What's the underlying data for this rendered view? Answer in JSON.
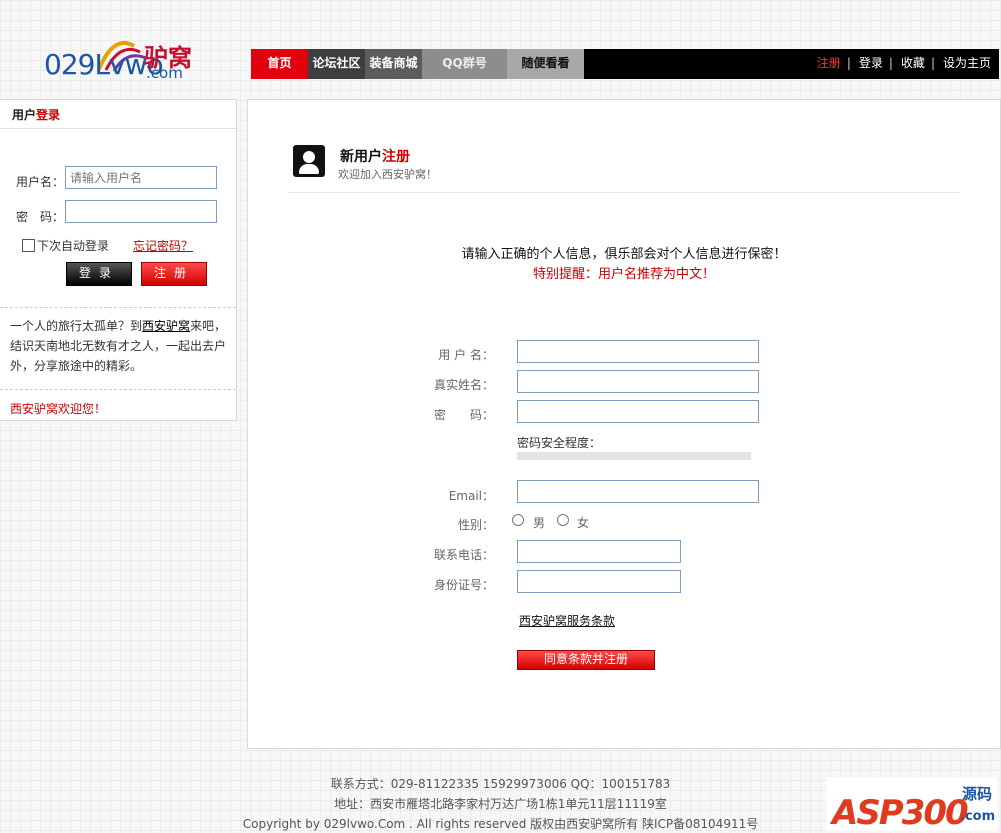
{
  "logo": {
    "text": "029Lvwo",
    "dotcom": ".com",
    "cn": "驴窝"
  },
  "nav": {
    "tabs": [
      "首页",
      "论坛社区",
      "装备商城",
      "QQ群号",
      "随便看看"
    ],
    "right": [
      "注册",
      "登录",
      "收藏",
      "设为主页"
    ],
    "colors": {
      "active": "#e3000e",
      "bar": "#000000"
    }
  },
  "login_panel": {
    "title_prefix": "用户",
    "title_highlight": "登录",
    "username_label": "用户名：",
    "username_placeholder": "请输入用户名",
    "password_label": "密　码：",
    "remember_label": "下次自动登录",
    "forgot_link": "忘记密码？",
    "login_button": "登录",
    "register_button": "注册",
    "intro_a": "一个人的旅行太孤单？到",
    "intro_link": "西安驴窝",
    "intro_b": "来吧，结识天南地北无数有才之人，一起出去户外，分享旅途中的精彩。",
    "welcome": "西安驴窝欢迎您！"
  },
  "register": {
    "title_prefix": "新用户",
    "title_highlight": "注册",
    "subtitle": "欢迎加入西安驴窝！",
    "notice": "请输入正确的个人信息，俱乐部会对个人信息进行保密！",
    "tip": "特别提醒：用户名推荐为中文！",
    "fields": {
      "username": "用 户 名：",
      "realname": "真实姓名：",
      "password": "密　　码：",
      "email": "Email：",
      "gender": "性别：",
      "phone": "联系电话：",
      "idcard": "身份证号："
    },
    "password_strength_label": "密码安全程度：",
    "gender_options": [
      "男",
      "女"
    ],
    "terms_link": "西安驴窝服务条款",
    "submit_button": "同意条款并注册"
  },
  "footer": {
    "contact": "联系方式：029-81122335 15929973006 QQ：100151783",
    "address": "地址：西安市雁塔北路李家村万达广场1栋1单元11层11119室",
    "copyright": "Copyright by 029lvwo.Com .  All rights reserved 版权由西安驴窝所有   陕ICP备08104911号"
  },
  "watermark": {
    "brand": "ASP300",
    "yuanma": "源码",
    "com": ".com"
  }
}
